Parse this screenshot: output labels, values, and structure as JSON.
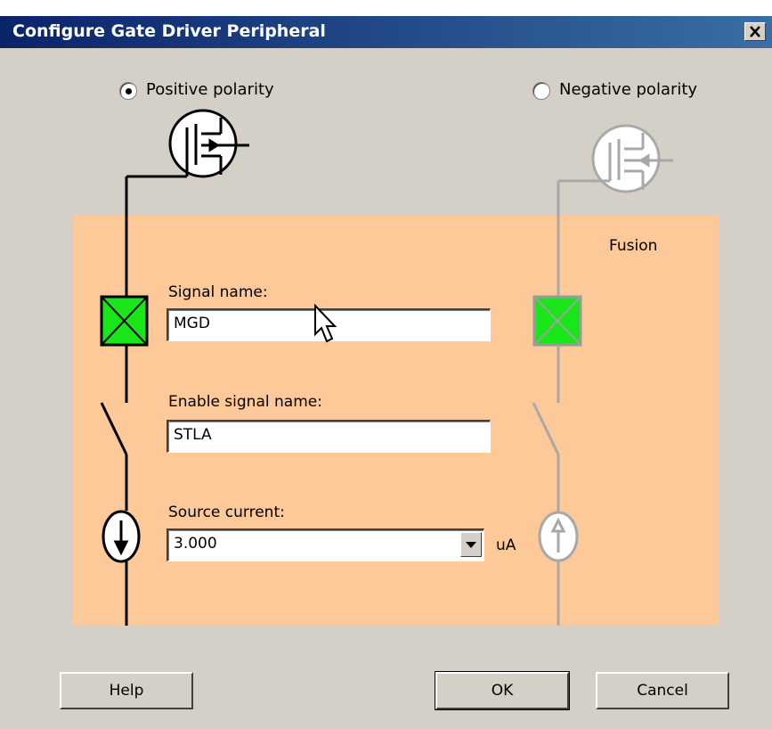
{
  "window": {
    "title": "Configure Gate Driver Peripheral"
  },
  "polarity": {
    "positive_label": "Positive polarity",
    "negative_label": "Negative polarity",
    "selected": "positive"
  },
  "panel": {
    "brand_label": "Fusion"
  },
  "fields": {
    "signal_name": {
      "label": "Signal name:",
      "value": "MGD"
    },
    "enable_signal_name": {
      "label": "Enable signal name:",
      "value": "STLA"
    },
    "source_current": {
      "label": "Source current:",
      "value": "3.000",
      "unit": "uA"
    }
  },
  "buttons": {
    "help": "Help",
    "ok": "OK",
    "cancel": "Cancel"
  },
  "icons": [
    "close-icon",
    "mosfet-icon",
    "switch-icon",
    "current-source-icon",
    "dropdown-arrow-icon",
    "cursor-icon"
  ],
  "colors": {
    "panel": "#fdc998",
    "dialog": "#d4d0c8",
    "titlebar": "#0a246a",
    "connector_green": "#19e619"
  }
}
